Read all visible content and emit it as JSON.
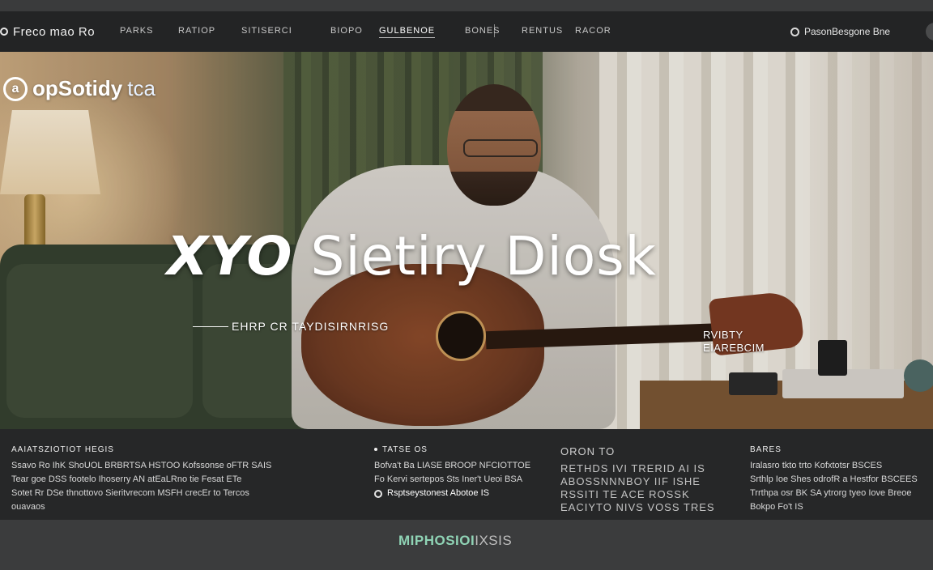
{
  "nav": {
    "brand": "Freco mao Ro",
    "links": [
      "Parks",
      "Ratiop",
      "Sitiserci",
      "Biopo",
      "Gulbenoe",
      "Bones",
      "Rentus",
      "Racor"
    ],
    "active_index": 4,
    "search_label": "PasonBesgone Bne"
  },
  "hero": {
    "logo_mark": "a",
    "logo_text": "opSotidy",
    "logo_suffix": "tca",
    "title_lead": "XYO",
    "title_main": "Sietiry Diosk",
    "subtitle": "EHRP CR TAYDISIRNRISG",
    "tag_lines": [
      "RVIBTY",
      "EIAREBCIM"
    ]
  },
  "info": {
    "col1": {
      "title": "AAIATSZIOTIOT HEGIS",
      "lines": [
        "Ssavo Ro IhK ShoUOL BRBRTSA HSTOO Kofssonse oFTR SAIS",
        "Tear goe DSS footelo Ihoserry AN atEaLRno tie Fesat ETe",
        "Sotet Rr DSe thnottovo Sieritvrecom MSFH crecEr to Tercos",
        "ouavaos"
      ]
    },
    "col2": {
      "title": "TATSE OS",
      "lines": [
        "Bofva't Ba LIASE BROOP NFCIOTTOE",
        "Fo Kervi sertepos Sts Iner't Ueoi BSA"
      ],
      "link": "Rsptseystonest Abotoe IS"
    },
    "col3": {
      "title": "ORON TO",
      "lines": [
        "RETHDS  IVI TRERID AI IS",
        "ABOSSNNNBOY IIF ISHE",
        "RSSITI TE ACE ROSSK",
        "EACIYTO NIVS VOSS TRES"
      ]
    },
    "col4": {
      "title": "BARES",
      "lines": [
        "Iralasro tkto trto Kofxtotsr BSCES",
        "Srthlp Ioe Shes odrofR a Hestfor BSCEES",
        "Trrthpa osr BK SA ytrorg tyeo Iove Breoe",
        "Bokpo Fo't IS"
      ]
    }
  },
  "footer": {
    "brand_a": "MIPHOSIOI",
    "brand_b": "IXSIS"
  },
  "colors": {
    "nav_bg": "#232425",
    "info_bg": "#262728",
    "footer_bg": "#3b3c3d",
    "accent": "#8fd3b5"
  }
}
